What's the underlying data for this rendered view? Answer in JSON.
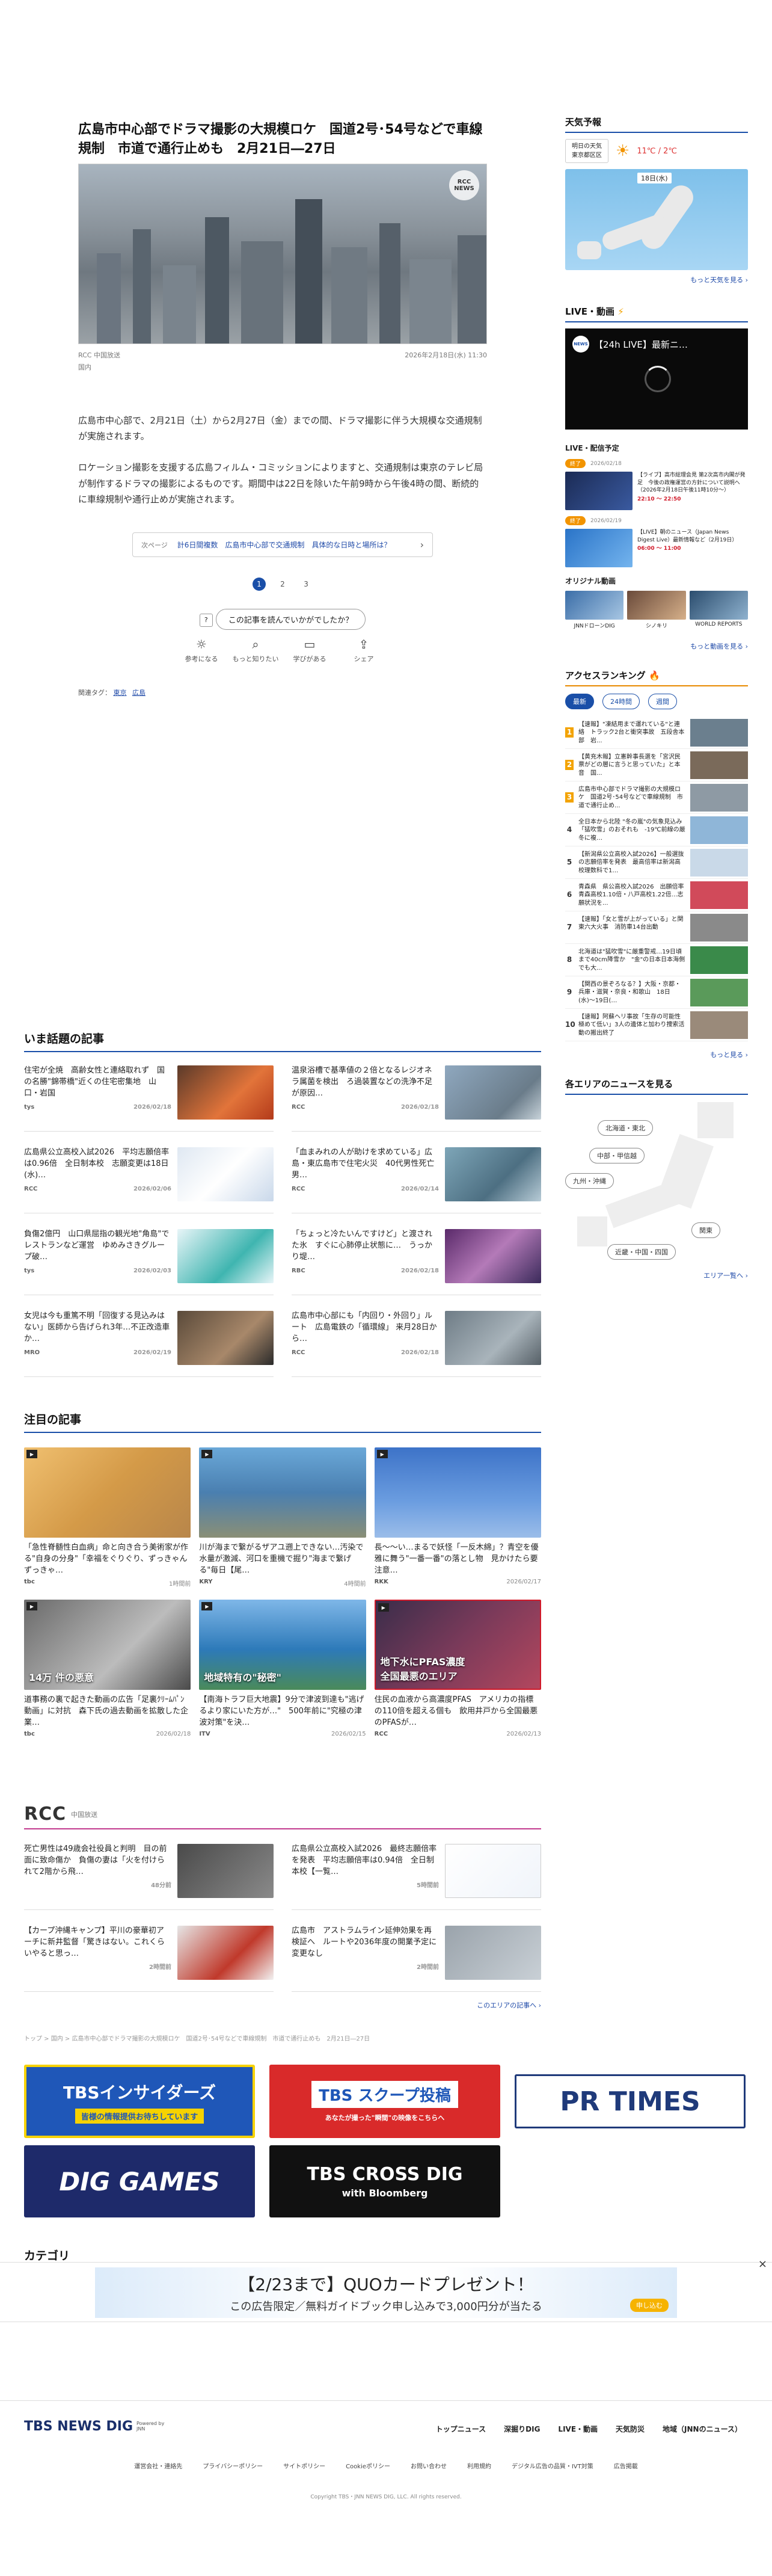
{
  "article": {
    "title": "広島市中心部でドラマ撮影の大規模ロケ　国道2号･54号などで車線規制　市道で通行止めも　2月21日―27日",
    "image_badge": "RCC NEWS",
    "source": "RCC 中国放送",
    "category": "国内",
    "datetime": "2026年2月18日(水) 11:30",
    "body1": "広島市中心部で、2月21日（土）から2月27日（金）までの間、ドラマ撮影に伴う大規模な交通規制が実施されます。",
    "body2": "ロケーション撮影を支援する広島フィルム・コミッションによりますと、交通規制は東京のテレビ局が制作するドラマの撮影によるものです。期間中は22日を除いた午前9時から午後4時の間、断続的に車線規制や通行止めが実施されます。",
    "next_label": "次ページ",
    "next_text": "計6日間複数　広島市中心部で交通規制　具体的な日時と場所は？",
    "pages": [
      "1",
      "2",
      "3"
    ],
    "feedback_question": "この記事を読んでいかがでしたか？",
    "reactions": [
      "参考になる",
      "もっと知りたい",
      "学びがある",
      "シェア"
    ],
    "tags_label": "関連タグ：",
    "tags": [
      "東京",
      "広島"
    ]
  },
  "trending": {
    "heading": "いま話題の記事",
    "items": [
      {
        "text": "住宅が全焼　高齢女性と連絡取れず　国の名勝\"錦帯橋\"近くの住宅密集地　山口・岩国",
        "src": "tys",
        "date": "2026/02/18"
      },
      {
        "text": "温泉浴槽で基準値の２倍となるレジオネラ属菌を検出　ろ過装置などの洗浄不足が原因…",
        "src": "RCC",
        "date": "2026/02/18"
      },
      {
        "text": "広島県公立高校入試2026　平均志願倍率は0.96倍　全日制本校　志願変更は18日(水)…",
        "src": "RCC",
        "date": "2026/02/06"
      },
      {
        "text": "「血まみれの人が助けを求めている」広島・東広島市で住宅火災　40代男性死亡　男…",
        "src": "RCC",
        "date": "2026/02/14"
      },
      {
        "text": "負傷2億円　山口県屈指の観光地\"角島\"でレストランなど運営　ゆめみさきグループ破…",
        "src": "tys",
        "date": "2026/02/03"
      },
      {
        "text": "「ちょっと冷たいんですけど」と渡された氷　すぐに心肺停止状態に…　うっかり堤…",
        "src": "RBC",
        "date": "2026/02/18"
      },
      {
        "text": "女児は今も重篤不明「回復する見込みはない」医師から告げられ3年…不正改造車か…",
        "src": "MRO",
        "date": "2026/02/19"
      },
      {
        "text": "広島市中心部にも「内回り・外回り」ルート　広島電鉄の「循環線」 来月28日から…",
        "src": "RCC",
        "date": "2026/02/18"
      }
    ]
  },
  "featured": {
    "heading": "注目の記事",
    "items": [
      {
        "text": "「急性脊髄性白血病」命と向き合う美術家が作る\"自身の分身\"「幸福をぐりぐり、ずっきゃんずっきゃ…",
        "src": "tbc",
        "date": "1時間前",
        "overlay": ""
      },
      {
        "text": "川が海まで繋がるザアユ遡上できない…汚染で水量が激減、河口を重機で掘り\"海まで繋げる\"毎日【尾…",
        "src": "KRY",
        "date": "4時間前",
        "overlay": ""
      },
      {
        "text": "長〜〜い…まるで妖怪「一反木綿」？青空を優雅に舞う\"一番一番\"の落とし物　見かけたら要注意…",
        "src": "RKK",
        "date": "2026/02/17",
        "overlay": ""
      },
      {
        "text": "道事務の裏で起きた動画の広告「足裏ｸﾘｰﾑﾊﾟﾝ動画」に対抗　森下氏の過去動画を拡散した企業…",
        "src": "tbc",
        "date": "2026/02/18",
        "overlay": "14万 件の悪意"
      },
      {
        "text": "【南海トラフ巨大地震】9分で津波到達も\"逃げるより家にいた方が…\"　500年前に\"究極の津波対策\"を決…",
        "src": "ITV",
        "date": "2026/02/15",
        "overlay": "地域特有の\"秘密\""
      },
      {
        "text": "住民の血液から高濃度PFAS　アメリカの指標の110倍を超える個も　飲用井戸から全国最悪のPFASが…",
        "src": "RCC",
        "date": "2026/02/13",
        "overlay": "地下水にPFAS濃度\n全国最悪のエリア"
      }
    ]
  },
  "rcc": {
    "logo": "RCC",
    "label": "中国放送",
    "items": [
      {
        "text": "死亡男性は49歳会社役員と判明　目の前面に致命傷か　負傷の妻は「火を付けられて2階から飛…",
        "date": "48分前"
      },
      {
        "text": "広島県公立高校入試2026　最終志願倍率を発表　平均志願倍率は0.94倍　全日制本校【一覧…",
        "date": "5時間前"
      },
      {
        "text": "【カープ沖縄キャンプ】平川の豪華初アーチに新井監督「驚きはない。これくらいやると思っ…",
        "date": "2時間前"
      },
      {
        "text": "広島市　アストラムライン延伸効果を再検証へ　ルートや2036年度の開業予定に変更なし",
        "date": "2時間前"
      }
    ],
    "more": "このエリアの記事へ ›"
  },
  "breadcrumb": "トップ > 国内 > 広島市中心部でドラマ撮影の大規模ロケ　国道2号･54号などで車線規制　市道で通行止めも　2月21日―27日",
  "banners": {
    "insider_title": "TBSインサイダーズ",
    "insider_sub": "皆様の情報提供お待ちしています",
    "scoop_title": "TBS スクープ投稿",
    "scoop_sub": "あなたが撮った\"瞬間\"の映像をこちらへ",
    "prtimes": "PR TIMES",
    "dig_games": "DIG GAMES",
    "cross_dig": "TBS CROSS DIG",
    "cross_dig_sub": "with Bloomberg"
  },
  "category_heading": "カテゴリ",
  "ad": {
    "line1": "【2/23まで】QUOカードプレゼント！",
    "line2": "この広告限定／無料ガイドブック申し込みで3,000円分が当たる",
    "cta": "申し込む"
  },
  "sidebar": {
    "weather_heading": "天気予報",
    "weather_day": "明日の天気",
    "weather_area": "東京都区区",
    "weather_temp": "11℃ / 2℃",
    "weather_date": "18日(水)",
    "weather_more": "もっと天気を見る ›",
    "live_heading": "LIVE・動画",
    "live_title": "【24h LIVE】最新ニ…",
    "live_list_heading": "LIVE・配信予定",
    "live_items": [
      {
        "badge": "終了",
        "date": "2026/02/18",
        "text": "【ライブ】高市総理会見 第2次高市内閣が発足　今後の政権運営の方針について説明へ（2026年2月18日午後11時10分〜）",
        "time": "22:10 〜 22:50"
      },
      {
        "badge": "終了",
        "date": "2026/02/19",
        "text": "【LIVE】朝のニュース（Japan News Digest Live）最新情報など（2月19日）",
        "time": "06:00 〜 11:00"
      }
    ],
    "original_heading": "オリジナル動画",
    "original_items": [
      "JNNドローンDIG",
      "シノキリ",
      "WORLD REPORTS"
    ],
    "video_more": "もっと動画を見る ›",
    "ranking_heading": "アクセスランキング",
    "ranking_tabs": [
      "最新",
      "24時間",
      "週間"
    ],
    "ranking": [
      {
        "n": "1",
        "text": "【速報】\"凍結用まで運れている\"と連絡　トラック2台と衝突事故　五段舎本部　岩..."
      },
      {
        "n": "2",
        "text": "【黄充木報】立憲幹事長選を「宮沢民票がどの層に言うと思っていた」と本音　国..."
      },
      {
        "n": "3",
        "text": "広島市中心部でドラマ撮影の大規模ロケ　国道2号･54号などで車線規制　市道で通行止め..."
      },
      {
        "n": "4",
        "text": "全日本から北陸 \"冬の嵐\"の気象見込み　「猛吹雪」のおそれも　-19℃前線の厳冬に複…"
      },
      {
        "n": "5",
        "text": "【新潟県公立高校入試2026】一般選抜の志願倍率を発表　最高倍率は新潟高校理数科で1…"
      },
      {
        "n": "6",
        "text": "青森県　県公高校入試2026　出願倍率 青森高校1.10倍・八戸高校1.22倍…志願状況を..."
      },
      {
        "n": "7",
        "text": "【速報】「女と雪が上がっている」と関東六大火事　消防車14台出動"
      },
      {
        "n": "8",
        "text": "北海道は\"猛吹雪\"に厳重警戒…19日頃まで40cm降雪か　\"金\"の日本日本海側でも大..."
      },
      {
        "n": "9",
        "text": "【関西の景ぞろなる？】大阪・京都・兵庫・滋賀・奈良・和歌山　18日(水)〜19日(…"
      },
      {
        "n": "10",
        "text": "【速報】阿蘇ヘリ事故「生存の可能性極めて低い」3人の遺体と加わり捜索活動の搬出終了"
      }
    ],
    "ranking_more": "もっと見る ›",
    "area_heading": "各エリアのニュースを見る",
    "areas": [
      "北海道・東北",
      "中部・甲信越",
      "九州・沖縄",
      "関東",
      "近畿・中国・四国"
    ],
    "area_more": "エリア一覧へ ›"
  },
  "footer": {
    "logo": "TBS NEWS DIG",
    "logo_sub": "Powered by JNN",
    "nav": [
      "トップニュース",
      "深掘りDIG",
      "LIVE・動画",
      "天気防災",
      "地域（JNNのニュース）"
    ],
    "links": [
      "運営会社・連絡先",
      "プライバシーポリシー",
      "サイトポリシー",
      "Cookieポリシー",
      "お問い合わせ",
      "利用規約",
      "デジタル広告の品質・IVT対策",
      "広告掲載"
    ],
    "copyright": "Copyright TBS・JNN NEWS DIG, LLC. All rights reserved."
  },
  "colors": {
    "accent": "#1a4fa8",
    "brand_red": "#d11a2a",
    "ranking_accent": "#e88a00"
  }
}
